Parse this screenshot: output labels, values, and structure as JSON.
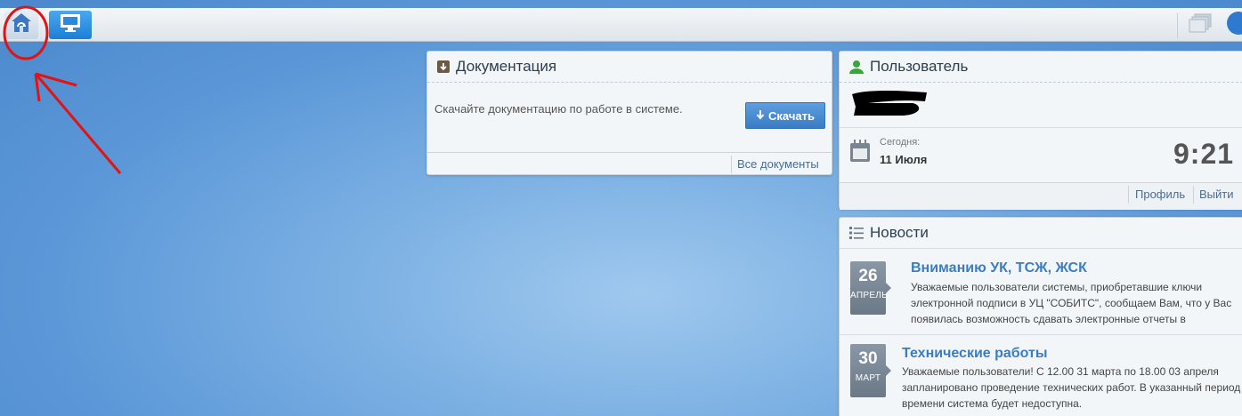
{
  "colors": {
    "accent": "#3b7dc3",
    "topbar": "#e8ecf0",
    "annotation": "#e01414"
  },
  "topbar": {
    "home_icon": "home-refresh-icon",
    "desktop_icon": "monitor-icon",
    "windows_icon": "windows-stack-icon"
  },
  "documentation": {
    "title": "Документация",
    "description": "Скачайте документацию по работе в системе.",
    "download_label": "Скачать",
    "all_docs_label": "Все документы"
  },
  "user": {
    "title": "Пользователь",
    "today_label": "Сегодня:",
    "today_date": "11 Июля",
    "time": "9:21",
    "profile_label": "Профиль",
    "logout_label": "Выйти"
  },
  "news": {
    "title": "Новости",
    "items": [
      {
        "day": "26",
        "month": "АПРЕЛЬ",
        "title": "Вниманию УК, ТСЖ, ЖСК",
        "text": "Уважаемые пользователи системы, приобретавшие ключи электронной подписи в УЦ \"СОБИТС\", сообщаем Вам, что у Вас появилась возможность сдавать электронные отчеты в"
      },
      {
        "day": "30",
        "month": "МАРТ",
        "title": "Технические работы",
        "text": "Уважаемые пользователи! С 12.00  31 марта по 18.00  03 апреля  запланировано проведение технических работ. В указанный период времени система будет недоступна."
      }
    ]
  }
}
